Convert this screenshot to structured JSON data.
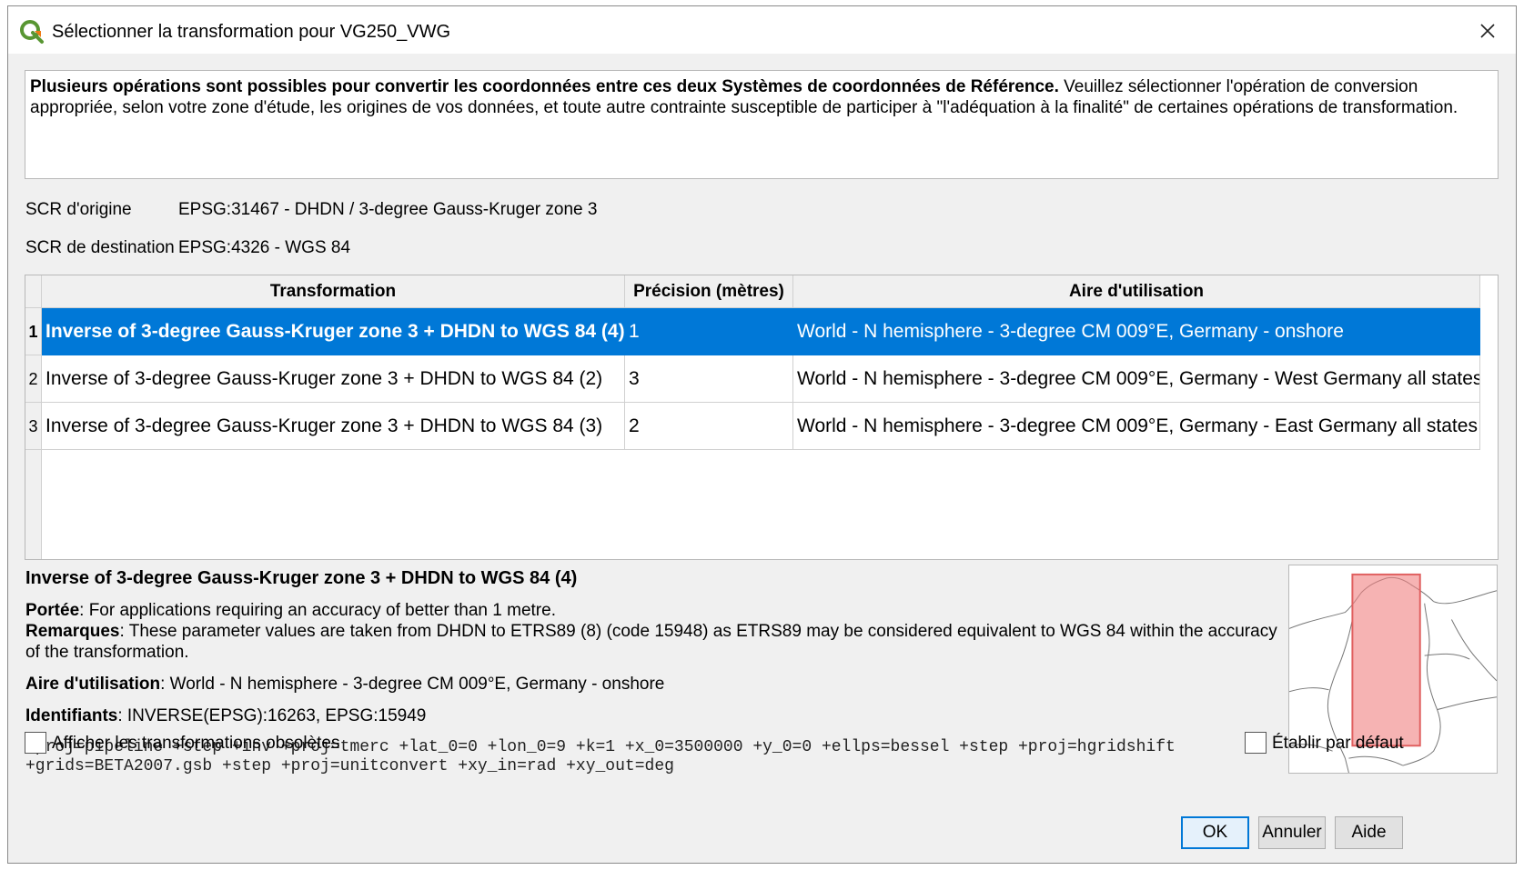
{
  "window": {
    "title": "Sélectionner la transformation pour VG250_VWG",
    "app_icon": "qgis-logo-icon",
    "close_icon": "close-icon"
  },
  "info": {
    "bold_text": "Plusieurs opérations sont possibles pour convertir les coordonnées entre ces deux Systèmes de  coordonnées de Référence.",
    "normal_text": " Veuillez sélectionner l'opération de conversion appropriée, selon votre zone d'étude, les origines de vos données, et toute autre contrainte susceptible de participer à \"l'adéquation à la finalité\" de certaines opérations de transformation."
  },
  "crs": {
    "source_label": "SCR d'origine",
    "source_value": "EPSG:31467 - DHDN / 3-degree Gauss-Kruger zone 3",
    "dest_label": "SCR de destination",
    "dest_value": "EPSG:4326 - WGS 84"
  },
  "table": {
    "columns": [
      "Transformation",
      "Précision (mètres)",
      "Aire d'utilisation"
    ],
    "rows": [
      {
        "num": "1",
        "transformation": "Inverse of 3-degree Gauss-Kruger zone 3 + DHDN to WGS 84 (4)",
        "precision": "1",
        "area": "World - N hemisphere - 3-degree CM 009°E, Germany - onshore",
        "selected": true
      },
      {
        "num": "2",
        "transformation": "Inverse of 3-degree Gauss-Kruger zone 3 + DHDN to WGS 84 (2)",
        "precision": "3",
        "area": "World - N hemisphere - 3-degree CM 009°E, Germany - West Germany all states",
        "selected": false
      },
      {
        "num": "3",
        "transformation": "Inverse of 3-degree Gauss-Kruger zone 3 + DHDN to WGS 84 (3)",
        "precision": "2",
        "area": "World - N hemisphere - 3-degree CM 009°E, Germany - East Germany all states",
        "selected": false
      }
    ]
  },
  "details": {
    "title": "Inverse of 3-degree Gauss-Kruger zone 3 + DHDN to WGS 84 (4)",
    "scope_label": "Portée",
    "scope_value": ": For applications requiring an accuracy of better than 1 metre.",
    "remarks_label": "Remarques",
    "remarks_value": ": These parameter values are taken from DHDN to ETRS89 (8) (code 15948) as ETRS89 may be considered equivalent to WGS 84 within the accuracy of the transformation.",
    "area_label": "Aire d'utilisation",
    "area_value": ": World - N hemisphere - 3-degree CM 009°E, Germany - onshore",
    "ids_label": "Identifiants",
    "ids_value": ": INVERSE(EPSG):16263, EPSG:15949",
    "proj_line1": "+proj=pipeline +step +inv +proj=tmerc +lat_0=0 +lon_0=9 +k=1 +x_0=3500000 +y_0=0 +ellps=bessel +step +proj=hgridshift",
    "proj_line2": "+grids=BETA2007.gsb +step +proj=unitconvert +xy_in=rad +xy_out=deg"
  },
  "options": {
    "show_deprecated": "Afficher les transformations obsolètes",
    "set_default": "Établir par défaut"
  },
  "buttons": {
    "ok": "OK",
    "cancel": "Annuler",
    "help": "Aide"
  },
  "colors": {
    "selection": "#0078d7",
    "area_fill": "#f08080"
  }
}
